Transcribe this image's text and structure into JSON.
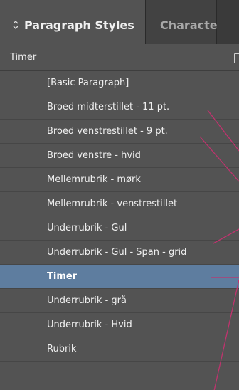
{
  "tabs": [
    {
      "label": "Paragraph Styles",
      "active": true,
      "icon": "up-down-chevron-icon"
    },
    {
      "label": "Characte",
      "active": false
    }
  ],
  "group": {
    "name": "Timer",
    "new_style_icon": "new-style-icon"
  },
  "styles": [
    {
      "label": "[Basic Paragraph]",
      "selected": false
    },
    {
      "label": "Broed midterstillet - 11 pt.",
      "selected": false
    },
    {
      "label": "Broed venstrestillet - 9 pt.",
      "selected": false
    },
    {
      "label": "Broed venstre - hvid",
      "selected": false
    },
    {
      "label": "Mellemrubrik - mørk",
      "selected": false
    },
    {
      "label": "Mellemrubrik - venstrestillet",
      "selected": false
    },
    {
      "label": "Underrubrik - Gul",
      "selected": false
    },
    {
      "label": "Underrubrik - Gul - Span - grid",
      "selected": false
    },
    {
      "label": "Timer",
      "selected": true
    },
    {
      "label": "Underrubrik - grå",
      "selected": false
    },
    {
      "label": "Underrubrik - Hvid",
      "selected": false
    },
    {
      "label": "Rubrik",
      "selected": false
    }
  ],
  "colors": {
    "panel": "#535353",
    "selection": "#5e7d9f",
    "annotation_lines": "#c0336e"
  }
}
